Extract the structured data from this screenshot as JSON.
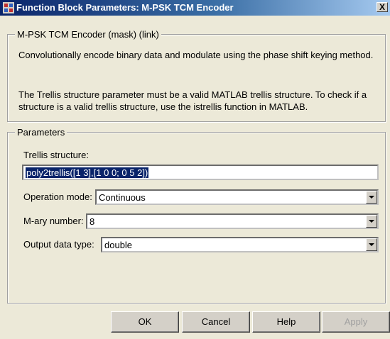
{
  "window": {
    "title": "Function Block Parameters: M-PSK TCM Encoder",
    "close_label": "X"
  },
  "mask": {
    "group_title": "M-PSK TCM Encoder (mask) (link)",
    "description_1": "Convolutionally encode binary data and modulate using the phase shift keying method.",
    "description_2": "The Trellis structure parameter must be a valid MATLAB trellis structure. To check if a structure is a valid trellis structure, use the istrellis function in MATLAB."
  },
  "parameters": {
    "group_title": "Parameters",
    "trellis_label": "Trellis structure:",
    "trellis_value": "poly2trellis([1 3],[1 0 0; 0 5 2])",
    "operation_label": "Operation mode:",
    "operation_value": "Continuous",
    "mary_label": "M-ary number:",
    "mary_value": "8",
    "output_label": "Output data type:",
    "output_value": "double"
  },
  "buttons": {
    "ok": "OK",
    "cancel": "Cancel",
    "help": "Help",
    "apply": "Apply"
  }
}
